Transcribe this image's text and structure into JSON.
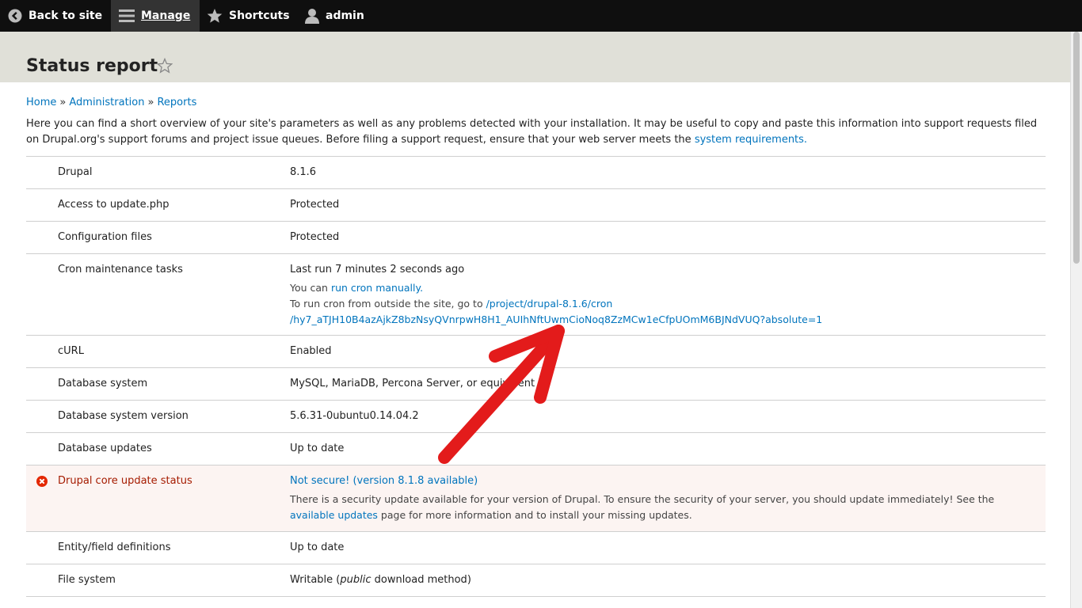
{
  "toolbar": {
    "back": "Back to site",
    "manage": "Manage",
    "shortcuts": "Shortcuts",
    "user": "admin"
  },
  "page": {
    "title": "Status report"
  },
  "breadcrumb": {
    "items": [
      "Home",
      "Administration",
      "Reports"
    ],
    "separator": "»"
  },
  "intro": {
    "text": "Here you can find a short overview of your site's parameters as well as any problems detected with your installation. It may be useful to copy and paste this information into support requests filed on Drupal.org's support forums and project issue queues. Before filing a support request, ensure that your web server meets the ",
    "link": "system requirements."
  },
  "rows": [
    {
      "label": "Drupal",
      "value": "8.1.6"
    },
    {
      "label": "Access to update.php",
      "value": "Protected"
    },
    {
      "label": "Configuration files",
      "value": "Protected"
    },
    {
      "label": "Cron maintenance tasks",
      "value": "Last run 7 minutes 2 seconds ago",
      "desc1_pre": "You can ",
      "desc1_link": "run cron manually.",
      "desc2_pre": "To run cron from outside the site, go to ",
      "desc2_link1": "/project/drupal-8.1.6/cron",
      "desc2_link2": "/hy7_aTJH10B4azAjkZ8bzNsyQVnrpwH8H1_AUIhNftUwmCioNoq8ZzMCw1eCfpUOmM6BJNdVUQ?absolute=1"
    },
    {
      "label": "cURL",
      "value": "Enabled"
    },
    {
      "label": "Database system",
      "value": "MySQL, MariaDB, Percona Server, or equivalent"
    },
    {
      "label": "Database system version",
      "value": "5.6.31-0ubuntu0.14.04.2"
    },
    {
      "label": "Database updates",
      "value": "Up to date"
    },
    {
      "label": "Drupal core update status",
      "value": "Not secure! (version 8.1.8 available)",
      "desc_pre": "There is a security update available for your version of Drupal. To ensure the security of your server, you should update immediately! See the ",
      "desc_link": "available updates",
      "desc_post": " page for more information and to install your missing updates.",
      "status": "error"
    },
    {
      "label": "Entity/field definitions",
      "value": "Up to date"
    },
    {
      "label": "File system",
      "value_pre": "Writable (",
      "value_em": "public",
      "value_post": " download method)"
    }
  ],
  "colors": {
    "toolbar_bg": "#0f0f0f",
    "manage_bg": "#333333",
    "header_bg": "#e0e0d8",
    "link": "#0074bd",
    "error_bg": "#fcf4f2",
    "error_text": "#a51b00",
    "error_icon": "#e32700",
    "annotation_arrow": "#e31b1b"
  },
  "icons": {
    "back": "chevron-left-circle-icon",
    "manage": "hamburger-icon",
    "shortcuts": "star-icon",
    "user": "user-icon",
    "title_star": "star-outline-icon",
    "error": "error-circle-icon",
    "annotation": "red-arrow-icon"
  }
}
